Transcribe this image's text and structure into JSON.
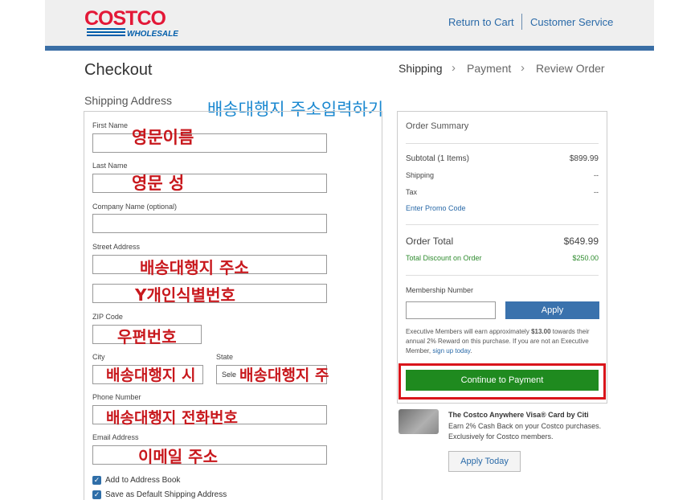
{
  "header": {
    "logo_top": "COSTCO",
    "logo_bottom": "WHOLESALE",
    "return_to_cart": "Return to Cart",
    "customer_service": "Customer Service"
  },
  "page": {
    "title": "Checkout",
    "steps": [
      "Shipping",
      "Payment",
      "Review Order"
    ],
    "section_label": "Shipping Address"
  },
  "form": {
    "first_name_label": "First Name",
    "last_name_label": "Last Name",
    "company_label": "Company Name (optional)",
    "street_label": "Street Address",
    "zip_label": "ZIP Code",
    "city_label": "City",
    "state_label": "State",
    "state_value": "Sele",
    "phone_label": "Phone Number",
    "email_label": "Email Address",
    "add_to_address_book": "Add to Address Book",
    "save_default": "Save as Default Shipping Address"
  },
  "annotations": {
    "headline": "배송대행지 주소입력하기",
    "first_name": "영문이름",
    "last_name": "영문 성",
    "street": "배송대행지 주소",
    "street2": "Y개인식별번호",
    "zip": "우편번호",
    "city": "배송대행지 시",
    "state": "배송대행지 주",
    "phone": "배송대행지 전화번호",
    "email": "이메일 주소"
  },
  "summary": {
    "title": "Order Summary",
    "subtotal_label": "Subtotal (1 Items)",
    "subtotal_value": "$899.99",
    "shipping_label": "Shipping",
    "shipping_value": "--",
    "tax_label": "Tax",
    "tax_value": "--",
    "promo_link": "Enter Promo Code",
    "order_total_label": "Order Total",
    "order_total_value": "$649.99",
    "discount_label": "Total Discount on Order",
    "discount_value": "$250.00",
    "membership_label": "Membership Number",
    "apply_label": "Apply",
    "exec_text_1": "Executive Members will earn approximately ",
    "exec_amount": "$13.00",
    "exec_text_2": " towards their annual 2% Reward on this purchase. If you are not an Executive Member, ",
    "exec_link": "sign up today",
    "exec_end": ".",
    "continue_label": "Continue to Payment"
  },
  "card": {
    "title": "The Costco Anywhere Visa® Card by Citi",
    "text": "Earn 2% Cash Back on your Costco purchases. Exclusively for Costco members.",
    "apply_today": "Apply Today"
  },
  "colors": {
    "header_bar": "#3a6ea5",
    "continue_button": "#1f8a1f",
    "annotation_red": "#c8181d",
    "annotation_blue": "#1a88d0",
    "highlight_box": "#d9151b"
  }
}
